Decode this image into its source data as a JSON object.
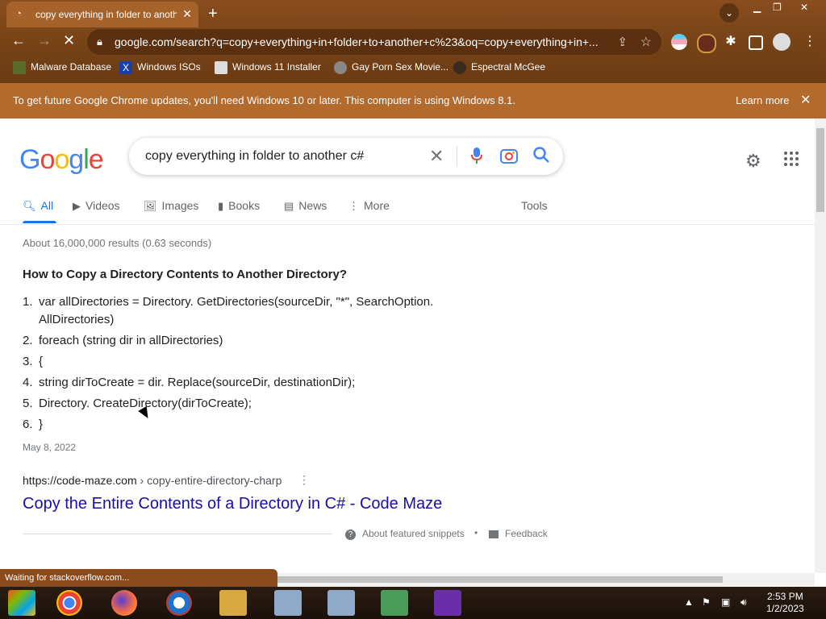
{
  "browser": {
    "tab_title": "copy everything in folder to anoth",
    "url": "google.com/search?q=copy+everything+in+folder+to+another+c%23&oq=copy+everything+in+...",
    "bookmarks": [
      {
        "label": "Malware Database",
        "icon": "malware-icon"
      },
      {
        "label": "Windows ISOs",
        "icon": "x-icon"
      },
      {
        "label": "Windows 11 Installer",
        "icon": "installer-icon"
      },
      {
        "label": "Gay Porn Sex Movie...",
        "icon": "site-icon"
      },
      {
        "label": "Espectral McGee",
        "icon": "avatar-icon"
      }
    ],
    "infobar": {
      "message": "To get future Google Chrome updates, you'll need Windows 10 or later. This computer is using Windows 8.1.",
      "learn_more": "Learn more"
    },
    "status": "Waiting for stackoverflow.com..."
  },
  "google": {
    "logo": [
      "G",
      "o",
      "o",
      "g",
      "l",
      "e"
    ],
    "query": "copy everything in folder to another c#",
    "tabs": [
      {
        "label": "All",
        "active": true,
        "icon": "search-icon"
      },
      {
        "label": "Videos",
        "icon": "video-icon"
      },
      {
        "label": "Images",
        "icon": "image-icon"
      },
      {
        "label": "Books",
        "icon": "book-icon"
      },
      {
        "label": "News",
        "icon": "news-icon"
      },
      {
        "label": "More",
        "icon": "more-icon"
      },
      {
        "label": "Tools"
      }
    ],
    "stats": "About 16,000,000 results (0.63 seconds)",
    "snippet": {
      "title": "How to Copy a Directory Contents to Another Directory?",
      "items": [
        "var allDirectories = Directory. GetDirectories(sourceDir, \"*\", SearchOption. AllDirectories)",
        "foreach (string dir in allDirectories)",
        "{",
        "string dirToCreate = dir. Replace(sourceDir, destinationDir);",
        "Directory. CreateDirectory(dirToCreate);",
        "}"
      ],
      "date": "May 8, 2022"
    },
    "result": {
      "site": "https://code-maze.com",
      "path": " › copy-entire-directory-charp",
      "title": "Copy the Entire Contents of a Directory in C# - Code Maze"
    },
    "footer": {
      "about": "About featured snippets",
      "dot": "•",
      "feedback": "Feedback"
    }
  },
  "taskbar": {
    "time": "2:53 PM",
    "date": "1/2/2023"
  },
  "colors": {
    "accent": "#1a73e8",
    "link": "#1a0dab",
    "chrome_theme": "#7a4518"
  }
}
